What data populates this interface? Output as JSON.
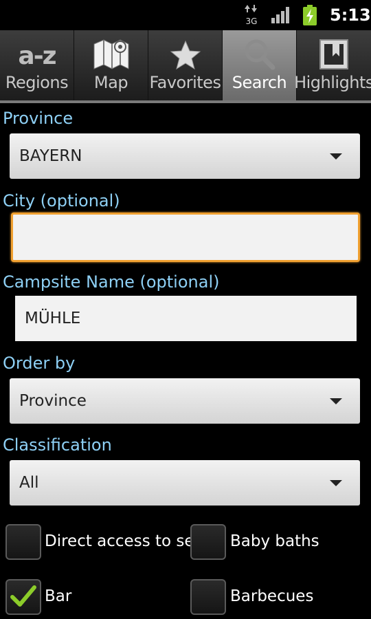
{
  "status_bar": {
    "network": "3G",
    "time": "5:13",
    "icons": [
      "data-arrows-icon",
      "signal-icon",
      "battery-charging-icon"
    ]
  },
  "tabs": [
    {
      "label": "Regions",
      "icon": "az-icon",
      "active": false
    },
    {
      "label": "Map",
      "icon": "map-icon",
      "active": false
    },
    {
      "label": "Favorites",
      "icon": "star-icon",
      "active": false
    },
    {
      "label": "Search",
      "icon": "search-icon",
      "active": true
    },
    {
      "label": "Highlights",
      "icon": "bookmark-icon",
      "active": false
    }
  ],
  "az_icon_text": "a-z",
  "form": {
    "province_label": "Province",
    "province_value": "BAYERN",
    "city_label": "City (optional)",
    "city_value": "",
    "campsite_label": "Campsite Name (optional)",
    "campsite_value": "MÜHLE",
    "order_label": "Order by",
    "order_value": "Province",
    "classification_label": "Classification",
    "classification_value": "All"
  },
  "filters": [
    {
      "label": "Direct access to sea",
      "checked": false
    },
    {
      "label": "Baby baths",
      "checked": false
    },
    {
      "label": "Bar",
      "checked": true
    },
    {
      "label": "Barbecues",
      "checked": false
    }
  ],
  "colors": {
    "label_blue": "#8ed0f5",
    "focus_orange": "#f0a030",
    "check_green": "#8ccc2a"
  }
}
